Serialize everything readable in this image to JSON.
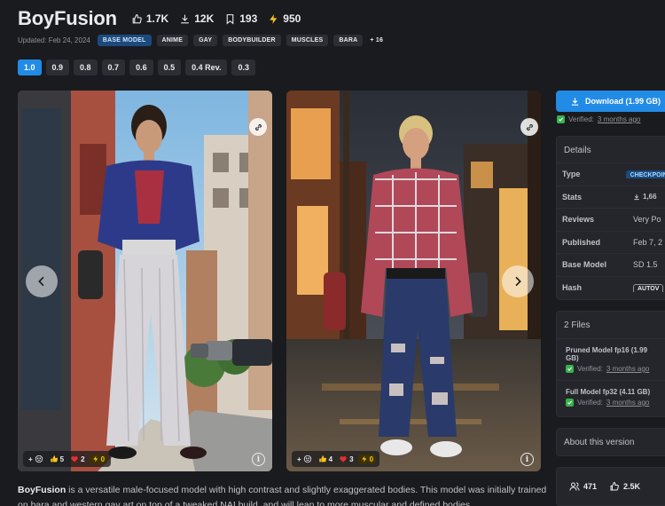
{
  "header": {
    "title": "BoyFusion",
    "stats": {
      "likes": "1.7K",
      "downloads": "12K",
      "bookmarks": "193",
      "buzz": "950"
    },
    "updated": "Updated: Feb 24, 2024",
    "tags": [
      "BASE MODEL",
      "ANIME",
      "GAY",
      "BODYBUILDER",
      "MUSCLES",
      "BARA"
    ],
    "more_tags": "+ 16"
  },
  "versions": {
    "items": [
      "1.0",
      "0.9",
      "0.8",
      "0.7",
      "0.6",
      "0.5",
      "0.4 Rev.",
      "0.3"
    ],
    "active": "1.0"
  },
  "gallery": {
    "images": [
      {
        "reactions": {
          "thumbs": "5",
          "heart": "2",
          "buzz": "0"
        }
      },
      {
        "reactions": {
          "thumbs": "4",
          "heart": "3",
          "buzz": "0"
        }
      }
    ]
  },
  "sidebar": {
    "download_label": "Download (1.99 GB)",
    "verified_prefix": "Verified:",
    "verified_when": "3 months ago",
    "details": {
      "title": "Details",
      "rows": [
        {
          "key": "Type",
          "value": "CHECKPOINT"
        },
        {
          "key": "Stats",
          "value": "1,66"
        },
        {
          "key": "Reviews",
          "value": "Very Po"
        },
        {
          "key": "Published",
          "value": "Feb 7, 2"
        },
        {
          "key": "Base Model",
          "value": "SD 1.5"
        },
        {
          "key": "Hash",
          "value": "AUTOV"
        }
      ]
    },
    "files": {
      "title": "2 Files",
      "items": [
        {
          "name": "Pruned Model fp16 (1.99 GB)",
          "verified_when": "3 months ago"
        },
        {
          "name": "Full Model fp32 (4.11 GB)",
          "verified_when": "3 months ago"
        }
      ]
    },
    "about_title": "About this version",
    "counts": {
      "users": "471",
      "likes": "2.5K"
    }
  },
  "description": {
    "name": "BoyFusion",
    "text": " is a versatile male-focused model with high contrast and slightly exaggerated bodies. This model was initially trained on bara and western gay art on top of a tweaked NAI build, and will lean to more muscular and defined bodies"
  },
  "colors": {
    "accent": "#228be6",
    "verified": "#37b24d",
    "buzz": "#fcc419"
  }
}
